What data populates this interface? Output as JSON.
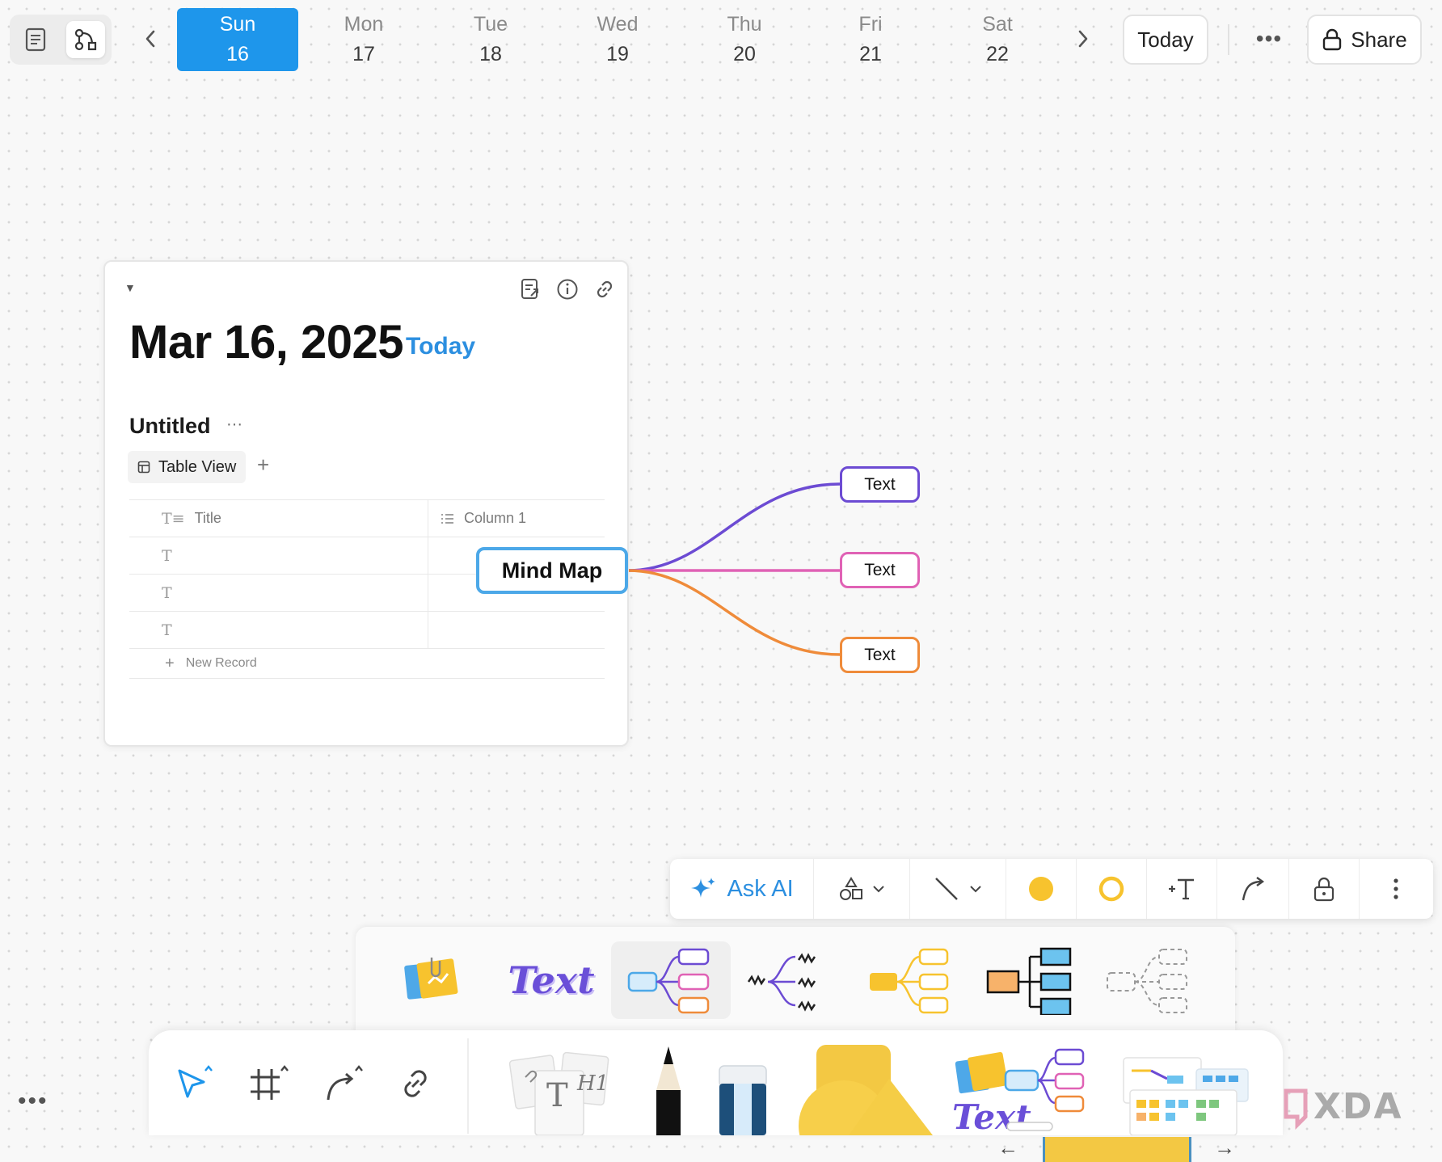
{
  "mode_switch": {
    "page_mode_icon": "page-icon",
    "edgeless_mode_icon": "edgeless-icon"
  },
  "week": {
    "prev_icon": "chevron-left-icon",
    "next_icon": "chevron-right-icon",
    "days": [
      {
        "name": "Sun",
        "num": "16",
        "active": true
      },
      {
        "name": "Mon",
        "num": "17"
      },
      {
        "name": "Tue",
        "num": "18"
      },
      {
        "name": "Wed",
        "num": "19"
      },
      {
        "name": "Thu",
        "num": "20"
      },
      {
        "name": "Fri",
        "num": "21"
      },
      {
        "name": "Sat",
        "num": "22"
      }
    ]
  },
  "header": {
    "today_label": "Today",
    "more_label": "•••",
    "share_label": "Share"
  },
  "journal": {
    "date": "Mar 16, 2025",
    "today_badge": "Today",
    "database": {
      "title": "Untitled",
      "more": "···",
      "view_label": "Table View",
      "add_view": "+",
      "columns": [
        "Title",
        "Column 1"
      ],
      "row_count": 3,
      "new_record_label": "New Record"
    }
  },
  "mindmap": {
    "root": "Mind Map",
    "children": [
      {
        "label": "Text",
        "color": "#6c4bd3"
      },
      {
        "label": "Text",
        "color": "#e062b5"
      },
      {
        "label": "Text",
        "color": "#ef8b3a"
      }
    ],
    "root_color": "#4ca8e8"
  },
  "format_toolbar": {
    "ask_ai": "Ask AI",
    "fill_color": "#f7c32e",
    "stroke_color": "#f7c32e"
  },
  "tray": {
    "text_sample": "Text"
  },
  "dock": {
    "text_sample": "Text",
    "note_sample": "H1",
    "more": "•••"
  },
  "colors": {
    "accent": "#1e96eb",
    "link_blue": "#2c8fe0"
  }
}
